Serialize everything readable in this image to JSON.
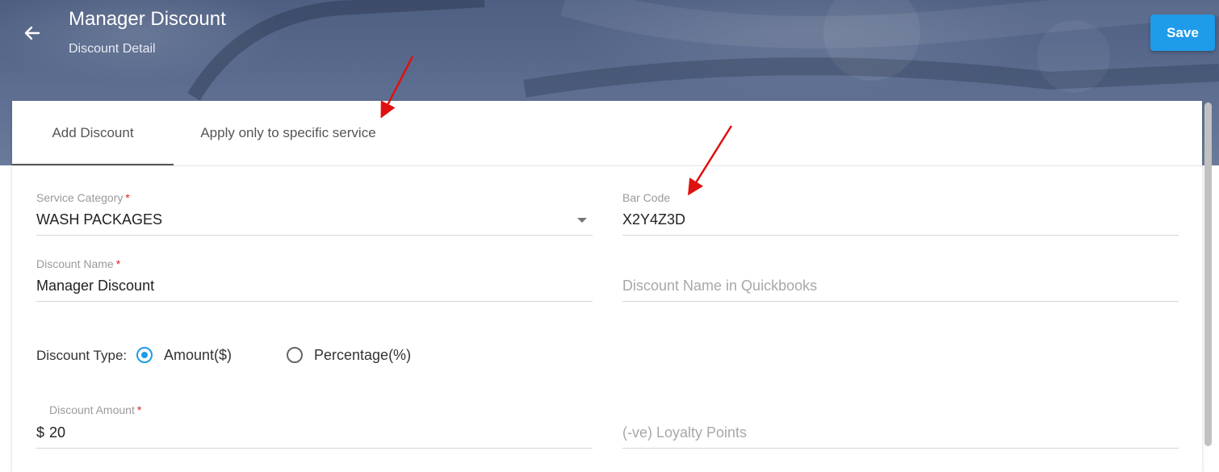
{
  "header": {
    "title": "Manager Discount",
    "subtitle": "Discount Detail",
    "save_label": "Save"
  },
  "tabs": [
    {
      "label": "Add Discount",
      "active": true
    },
    {
      "label": "Apply only to specific service",
      "active": false
    }
  ],
  "form": {
    "service_category": {
      "label": "Service Category",
      "required_mark": "*",
      "value": "WASH PACKAGES"
    },
    "bar_code": {
      "label": "Bar Code",
      "value": "X2Y4Z3D"
    },
    "discount_name": {
      "label": "Discount Name",
      "required_mark": "*",
      "value": "Manager Discount"
    },
    "quickbooks_name": {
      "placeholder": "Discount Name in Quickbooks",
      "value": ""
    },
    "discount_type": {
      "label": "Discount Type:",
      "options": [
        {
          "label": "Amount($)",
          "selected": true
        },
        {
          "label": "Percentage(%)",
          "selected": false
        }
      ]
    },
    "discount_amount": {
      "label": "Discount Amount",
      "required_mark": "*",
      "currency_symbol": "$",
      "value": "20"
    },
    "loyalty_points": {
      "placeholder": "(-ve) Loyalty Points",
      "value": ""
    }
  },
  "colors": {
    "accent": "#1e9be9",
    "header_bg": "#56678a",
    "required": "#e02020",
    "annotation_arrow": "#e01010"
  },
  "icons": {
    "back": "arrow-left-icon",
    "dropdown": "chevron-down-icon"
  }
}
